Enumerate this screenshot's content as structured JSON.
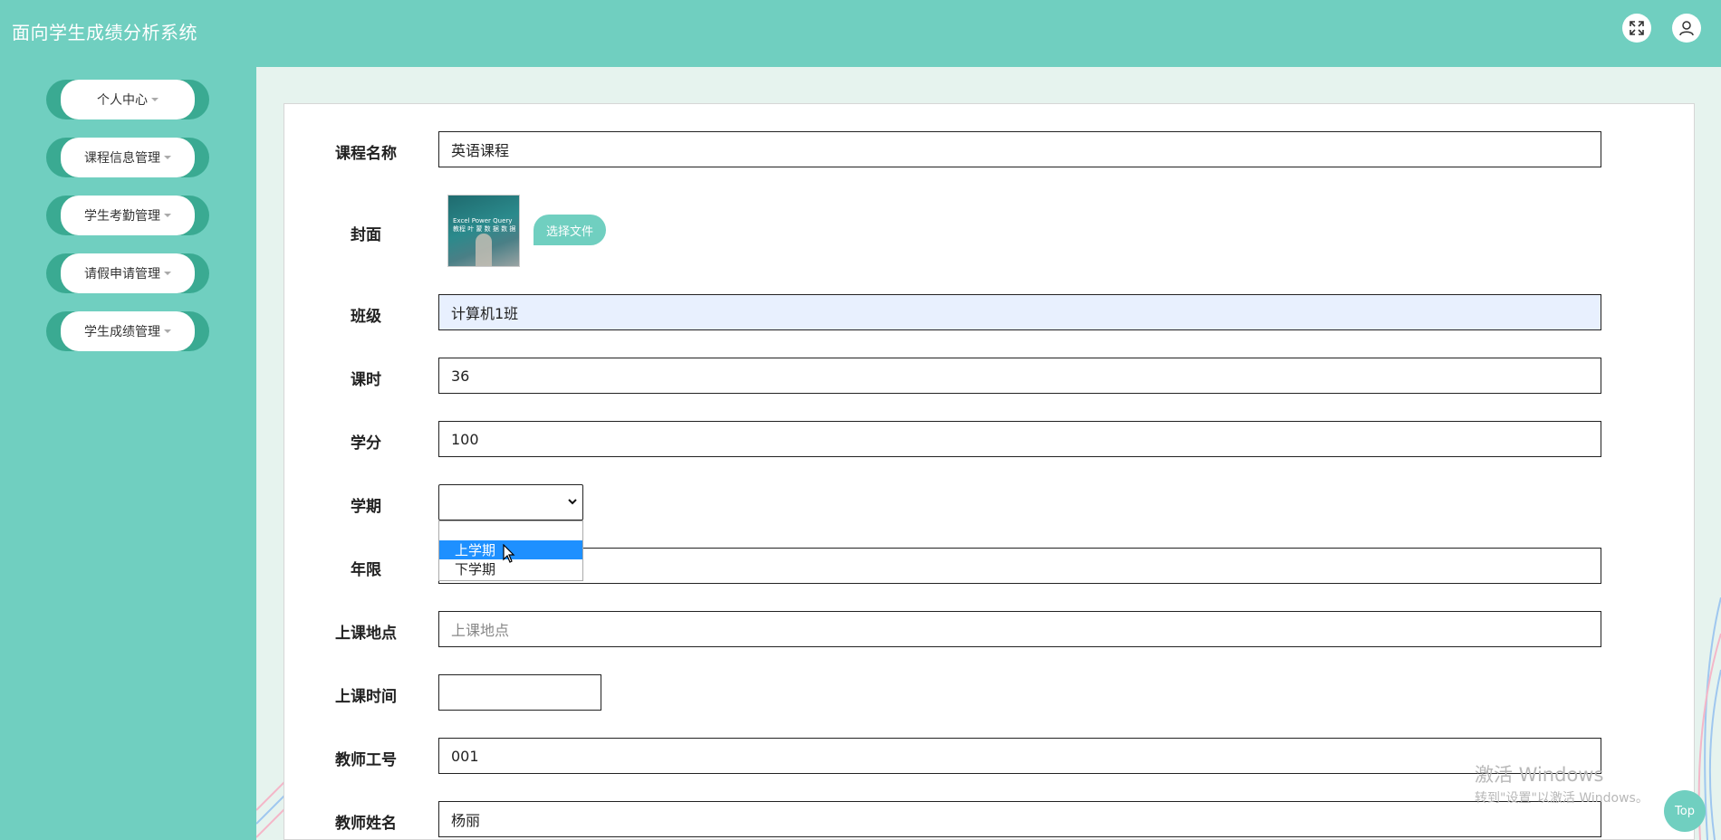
{
  "header": {
    "title": "面向学生成绩分析系统"
  },
  "sidebar": {
    "items": [
      {
        "label": "个人中心"
      },
      {
        "label": "课程信息管理"
      },
      {
        "label": "学生考勤管理"
      },
      {
        "label": "请假申请管理"
      },
      {
        "label": "学生成绩管理"
      }
    ]
  },
  "form": {
    "course_name": {
      "label": "课程名称",
      "value": "英语课程"
    },
    "cover": {
      "label": "封面",
      "button_label": "选择文件",
      "image_text": "Excel Power Query 教程  叶 蒙 数 据 数 据"
    },
    "class": {
      "label": "班级",
      "value": "计算机1班"
    },
    "hours": {
      "label": "课时",
      "value": "36"
    },
    "credit": {
      "label": "学分",
      "value": "100"
    },
    "semester": {
      "label": "学期",
      "value": "",
      "options": [
        "",
        "上学期",
        "下学期"
      ],
      "highlighted": "上学期"
    },
    "years": {
      "label": "年限",
      "value": ""
    },
    "location": {
      "label": "上课地点",
      "value": "",
      "placeholder": "上课地点"
    },
    "time": {
      "label": "上课时间",
      "value": ""
    },
    "teacher_id": {
      "label": "教师工号",
      "value": "001"
    },
    "teacher_name": {
      "label": "教师姓名",
      "value": "杨丽"
    }
  },
  "watermark": {
    "line1": "激活 Windows",
    "line2": "转到\"设置\"以激活 Windows。"
  },
  "top_button": {
    "label": "Top"
  },
  "colors": {
    "primary": "#70cfc0",
    "sidebar_btn_edge": "#3aaa92",
    "select_highlight": "#1e90ff",
    "content_bg": "#e6f3ee"
  }
}
